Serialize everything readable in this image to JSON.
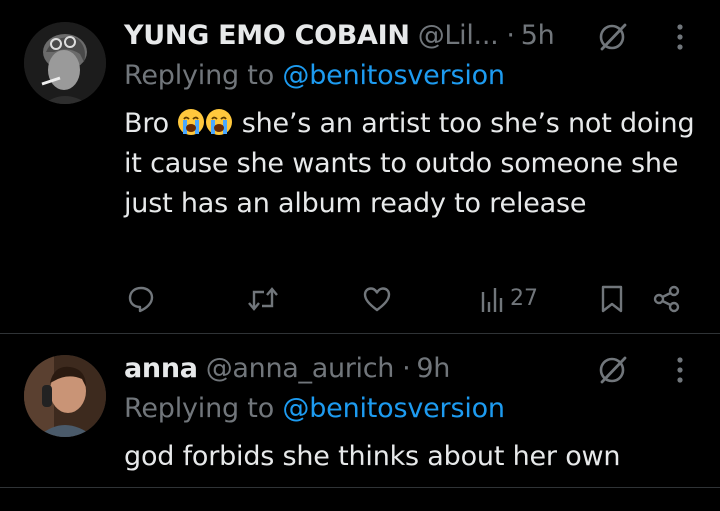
{
  "tweets": [
    {
      "display_name": "YUNG EMO COBAIN",
      "handle": "@Lil...",
      "separator": "·",
      "time": "5h",
      "replying_prefix": "Replying to",
      "replying_to": "@benitosversion",
      "text_before_emoji": "Bro",
      "emoji": "loudly-crying-face",
      "text_after_emoji": "she’s an artist too she’s not doing it cause she wants to outdo someone she just has an album ready to release",
      "actions": {
        "views": "27"
      }
    },
    {
      "display_name": "anna",
      "handle": "@anna_aurich",
      "separator": "·",
      "time": "9h",
      "replying_prefix": "Replying to",
      "replying_to": "@benitosversion",
      "text": "god forbids she thinks about her own"
    }
  ],
  "colors": {
    "background": "#000000",
    "text": "#e7e9ea",
    "secondary": "#71767b",
    "link": "#1d9bf0",
    "divider": "#2f3336"
  },
  "icons": [
    "grok-icon",
    "more-icon",
    "reply-icon",
    "retweet-icon",
    "like-icon",
    "views-icon",
    "bookmark-icon",
    "share-icon"
  ]
}
